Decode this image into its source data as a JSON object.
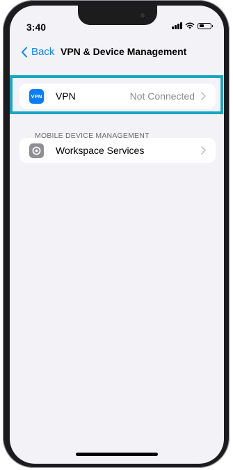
{
  "status_bar": {
    "time": "3:40",
    "icons": [
      "cellular-signal-icon",
      "wifi-icon",
      "battery-icon"
    ]
  },
  "nav": {
    "back_label": "Back",
    "title": "VPN & Device Management"
  },
  "vpn_row": {
    "icon_text": "VPN",
    "label": "VPN",
    "value": "Not Connected"
  },
  "mdm_section": {
    "header": "MOBILE DEVICE MANAGEMENT"
  },
  "mdm_row": {
    "label": "Workspace Services"
  },
  "colors": {
    "accent": "#0a84ff",
    "highlight": "#19a6c2",
    "background": "#f2f2f7"
  }
}
